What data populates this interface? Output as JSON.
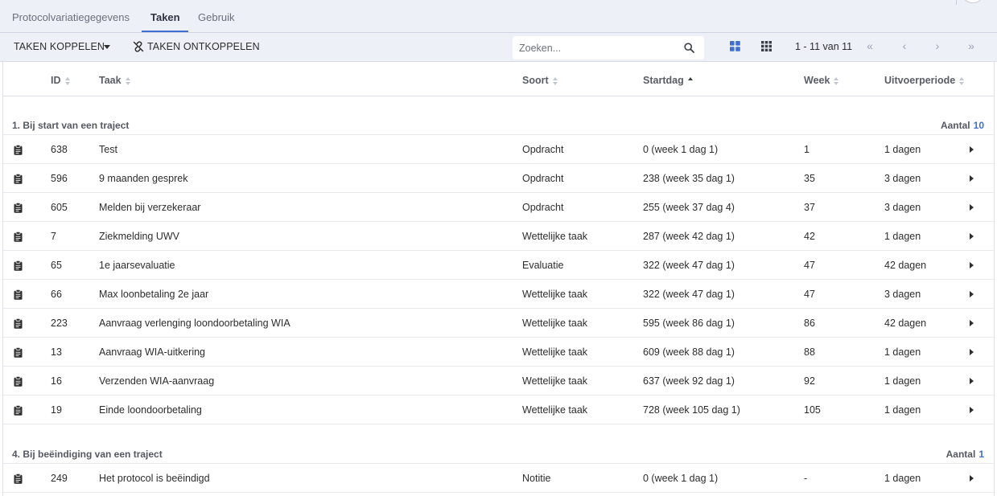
{
  "tabs": [
    {
      "label": "Protocolvariatiegegevens",
      "active": false
    },
    {
      "label": "Taken",
      "active": true
    },
    {
      "label": "Gebruik",
      "active": false
    }
  ],
  "toolbar": {
    "link_label": "TAKEN KOPPELEN",
    "unlink_label": "TAKEN ONTKOPPELEN",
    "search_placeholder": "Zoeken...",
    "pager_text": "1 - 11 van 11",
    "accent": "#3f6fd1"
  },
  "columns": {
    "id": "ID",
    "taak": "Taak",
    "soort": "Soort",
    "startdag": "Startdag",
    "week": "Week",
    "uitvoerperiode": "Uitvoerperiode"
  },
  "groups": [
    {
      "title": "1. Bij start van een traject",
      "count_label": "Aantal",
      "count": "10",
      "rows": [
        {
          "id": "638",
          "taak": "Test",
          "soort": "Opdracht",
          "startdag": "0 (week 1 dag 1)",
          "week": "1",
          "periode": "1 dagen"
        },
        {
          "id": "596",
          "taak": "9 maanden gesprek",
          "soort": "Opdracht",
          "startdag": "238 (week 35 dag 1)",
          "week": "35",
          "periode": "3 dagen"
        },
        {
          "id": "605",
          "taak": "Melden bij verzekeraar",
          "soort": "Opdracht",
          "startdag": "255 (week 37 dag 4)",
          "week": "37",
          "periode": "3 dagen"
        },
        {
          "id": "7",
          "taak": "Ziekmelding UWV",
          "soort": "Wettelijke taak",
          "startdag": "287 (week 42 dag 1)",
          "week": "42",
          "periode": "1 dagen"
        },
        {
          "id": "65",
          "taak": "1e jaarsevaluatie",
          "soort": "Evaluatie",
          "startdag": "322 (week 47 dag 1)",
          "week": "47",
          "periode": "42 dagen"
        },
        {
          "id": "66",
          "taak": "Max loonbetaling 2e jaar",
          "soort": "Wettelijke taak",
          "startdag": "322 (week 47 dag 1)",
          "week": "47",
          "periode": "3 dagen"
        },
        {
          "id": "223",
          "taak": "Aanvraag verlenging loondoorbetaling WIA",
          "soort": "Wettelijke taak",
          "startdag": "595 (week 86 dag 1)",
          "week": "86",
          "periode": "42 dagen"
        },
        {
          "id": "13",
          "taak": "Aanvraag WIA-uitkering",
          "soort": "Wettelijke taak",
          "startdag": "609 (week 88 dag 1)",
          "week": "88",
          "periode": "1 dagen"
        },
        {
          "id": "16",
          "taak": "Verzenden WIA-aanvraag",
          "soort": "Wettelijke taak",
          "startdag": "637 (week 92 dag 1)",
          "week": "92",
          "periode": "1 dagen"
        },
        {
          "id": "19",
          "taak": "Einde loondoorbetaling",
          "soort": "Wettelijke taak",
          "startdag": "728 (week 105 dag 1)",
          "week": "105",
          "periode": "1 dagen"
        }
      ]
    },
    {
      "title": "4. Bij beëindiging van een traject",
      "count_label": "Aantal",
      "count": "1",
      "rows": [
        {
          "id": "249",
          "taak": "Het protocol is beëindigd",
          "soort": "Notitie",
          "startdag": "0 (week 1 dag 1)",
          "week": "-",
          "periode": "1 dagen"
        }
      ]
    }
  ]
}
